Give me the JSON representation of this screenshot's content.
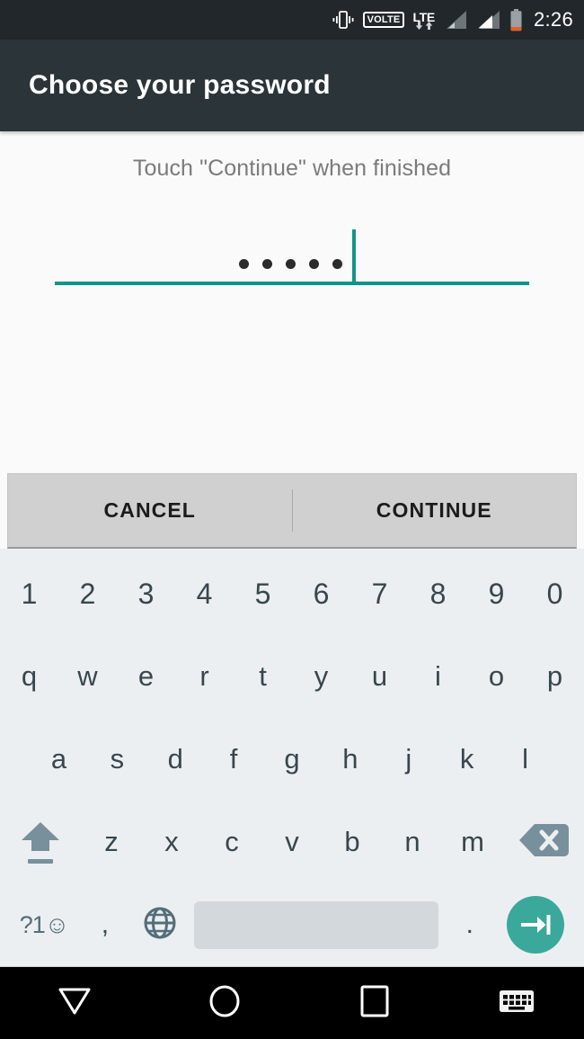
{
  "statusbar": {
    "icons": [
      "vibrate-icon",
      "volte-icon",
      "lte-icon",
      "signal-1-icon",
      "signal-2-icon",
      "battery-icon"
    ],
    "volte_label": "VOLTE",
    "lte_label": "LTE",
    "time": "2:26"
  },
  "header": {
    "title": "Choose your password"
  },
  "content": {
    "subtitle": "Touch \"Continue\" when finished",
    "password_field": {
      "value": "•••••",
      "masked_char_count": 5,
      "caret_visible": true,
      "accent_color": "#0f9488"
    }
  },
  "actionbar": {
    "cancel_label": "CANCEL",
    "continue_label": "CONTINUE"
  },
  "keyboard": {
    "row_numbers": [
      "1",
      "2",
      "3",
      "4",
      "5",
      "6",
      "7",
      "8",
      "9",
      "0"
    ],
    "row_top": [
      "q",
      "w",
      "e",
      "r",
      "t",
      "y",
      "u",
      "i",
      "o",
      "p"
    ],
    "row_home": [
      "a",
      "s",
      "d",
      "f",
      "g",
      "h",
      "j",
      "k",
      "l"
    ],
    "row_bottom": [
      "z",
      "x",
      "c",
      "v",
      "b",
      "n",
      "m"
    ],
    "shift_key": "shift-icon",
    "delete_key": "backspace-icon",
    "symbols_key": "?1☺",
    "comma_key": ",",
    "language_key": "globe-icon",
    "space_key": "spacebar",
    "period_key": ".",
    "enter_key": "tab-next-icon",
    "enter_color": "#3aa99c",
    "background_color": "#eceff1"
  },
  "navbar": {
    "back": "back-triangle-icon",
    "home": "home-circle-icon",
    "recents": "recents-square-icon",
    "hide_keyboard": "hide-keyboard-icon"
  }
}
